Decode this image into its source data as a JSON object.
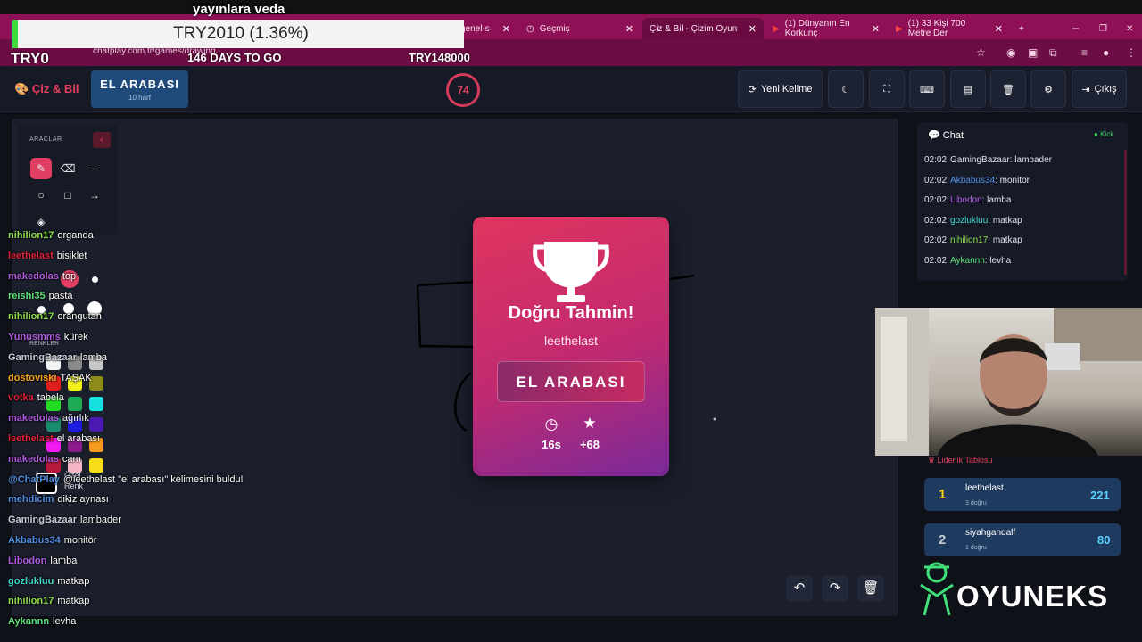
{
  "overlay": {
    "title": "yayınlara veda",
    "bar_text": "TRY2010 (1.36%)",
    "try0": "TRY0",
    "days": "146 DAYS TO GO",
    "goal": "TRY148000"
  },
  "browser": {
    "tabs": [
      {
        "label": "genel-s",
        "active": false
      },
      {
        "label": "Geçmiş",
        "active": false
      },
      {
        "label": "Çiz & Bil - Çizim Oyun",
        "active": true
      },
      {
        "label": "(1) Dünyanın En Korkunç",
        "active": false
      },
      {
        "label": "(1) 33 Kişi 700 Metre Der",
        "active": false
      }
    ],
    "url": "chatplay.com.tr/games/drawing..."
  },
  "header": {
    "logo": "Çiz & Bil",
    "word": "EL ARABASI",
    "word_sub": "10 harf",
    "timer": "74",
    "new_word": "Yeni Kelime",
    "exit": "Çıkış"
  },
  "tools": {
    "title": "ARAÇLAR",
    "colors_title": "RENKLER",
    "custom_color": "Özel Renk",
    "selected_size_index": 1,
    "swatches": [
      "#f5f5f5",
      "#8a8a8a",
      "#c7c7c7",
      "#e01e1e",
      "#f2f21a",
      "#8c8c1a",
      "#22dd22",
      "#1faa55",
      "#14e0e0",
      "#1a8c6e",
      "#1d1de0",
      "#4b1ab0",
      "#f21af2",
      "#8c1a8c",
      "#f59a1a",
      "#b51a3a",
      "#f5b5c5",
      "#f5dd1a"
    ]
  },
  "card": {
    "title": "Doğru Tahmin!",
    "user": "leethelast",
    "word": "EL ARABASI",
    "time": "16s",
    "points": "+68"
  },
  "chat": {
    "title": "Chat",
    "kick": "Kick",
    "messages": [
      {
        "time": "02:02",
        "user": "GamingBazaar",
        "text": ": lambader",
        "color": "#dfe2ea"
      },
      {
        "time": "02:02",
        "user": "Akbabus34",
        "text": ": monitör",
        "color": "#4f8fe0"
      },
      {
        "time": "02:02",
        "user": "Libodon",
        "text": ": lamba",
        "color": "#b25be0"
      },
      {
        "time": "02:02",
        "user": "gozlukluu",
        "text": ": matkap",
        "color": "#3fd9c9"
      },
      {
        "time": "02:02",
        "user": "nihilion17",
        "text": ": matkap",
        "color": "#8fe04f"
      },
      {
        "time": "02:02",
        "user": "Aykannn",
        "text": ": levha",
        "color": "#5fe07a"
      }
    ]
  },
  "leaderboard": {
    "title": "Liderlik Tablosu",
    "rows": [
      {
        "rank": "1",
        "name": "leethelast",
        "sub": "3 doğru",
        "score": "221",
        "rank_color": "#f5d21a"
      },
      {
        "rank": "2",
        "name": "siyahgandalf",
        "sub": "1 doğru",
        "score": "80",
        "rank_color": "#c7ccd6"
      }
    ]
  },
  "brand": "OYUNEKS",
  "stream_chat": [
    {
      "user": "nihilion17",
      "text": "organda",
      "color": "#8fe04f"
    },
    {
      "user": "leethelast",
      "text": "bisiklet",
      "color": "#e0243a"
    },
    {
      "user": "makedolas",
      "text": "top",
      "color": "#b25be0"
    },
    {
      "user": "reishi35",
      "text": "pasta",
      "color": "#5fe07a"
    },
    {
      "user": "nihilion17",
      "text": "orangutan",
      "color": "#8fe04f"
    },
    {
      "user": "Yunusmms",
      "text": "kürek",
      "color": "#b25be0"
    },
    {
      "user": "GamingBazaar",
      "text": "lamba",
      "color": "#c7ccd6"
    },
    {
      "user": "dostoviski",
      "text": "TAŞAK",
      "color": "#f5a21a"
    },
    {
      "user": "votka",
      "text": "tabela",
      "color": "#e0243a"
    },
    {
      "user": "makedolas",
      "text": "ağırlık",
      "color": "#b25be0"
    },
    {
      "user": "leethelast",
      "text": "el arabası",
      "color": "#e0243a"
    },
    {
      "user": "makedolas",
      "text": "cam",
      "color": "#b25be0"
    },
    {
      "user": "@ChatPlay",
      "text": "@leethelast \"el arabası\" kelimesini buldu!",
      "color": "#4f8fe0"
    },
    {
      "user": "mehdicim",
      "text": "dikiz aynası",
      "color": "#4f8fe0"
    },
    {
      "user": "GamingBazaar",
      "text": "lambader",
      "color": "#c7ccd6"
    },
    {
      "user": "Akbabus34",
      "text": "monitör",
      "color": "#4f8fe0"
    },
    {
      "user": "Libodon",
      "text": "lamba",
      "color": "#b25be0"
    },
    {
      "user": "gozlukluu",
      "text": "matkap",
      "color": "#3fd9c9"
    },
    {
      "user": "nihilion17",
      "text": "matkap",
      "color": "#8fe04f"
    },
    {
      "user": "Aykannn",
      "text": "levha",
      "color": "#5fe07a"
    }
  ]
}
